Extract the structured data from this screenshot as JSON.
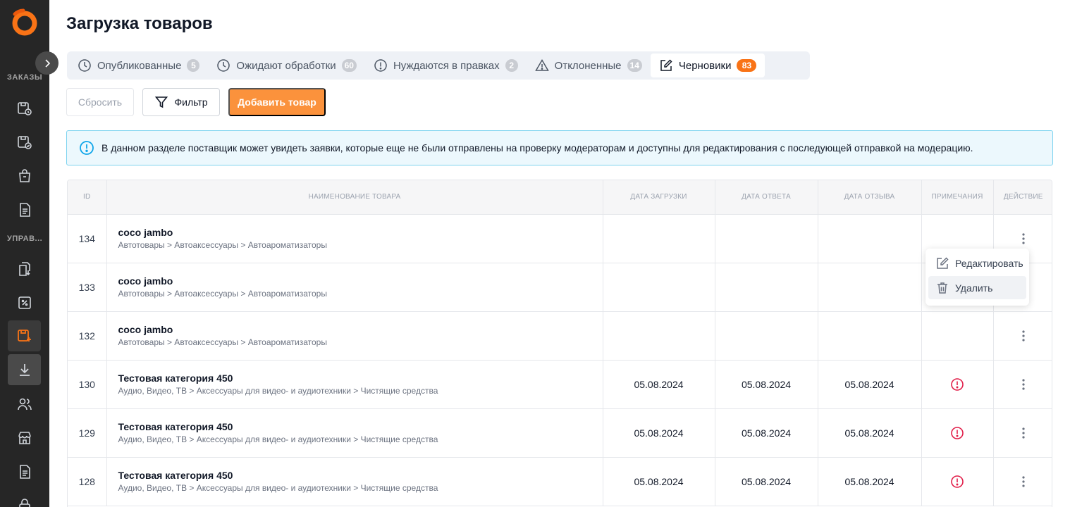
{
  "sidebar": {
    "section_orders": "ЗАКАЗЫ",
    "section_manage": "УПРАВ..."
  },
  "page": {
    "title": "Загрузка товаров"
  },
  "tabs": [
    {
      "label": "Опубликованные",
      "count": "5"
    },
    {
      "label": "Ожидают обработки",
      "count": "60"
    },
    {
      "label": "Нуждаются в правках",
      "count": "2"
    },
    {
      "label": "Отклоненные",
      "count": "14"
    },
    {
      "label": "Черновики",
      "count": "83"
    }
  ],
  "toolbar": {
    "reset_label": "Сбросить",
    "filter_label": "Фильтр",
    "add_label": "Добавить товар"
  },
  "info_text": "В данном разделе поставщик может увидеть заявки, которые еще не были отправлены на проверку модераторам и доступны для редактирования с последующей отправкой на модерацию.",
  "table": {
    "headers": {
      "id": "ID",
      "name": "НАИМЕНОВАНИЕ ТОВАРА",
      "upload_date": "ДАТА ЗАГРУЗКИ",
      "answer_date": "ДАТА ОТВЕТА",
      "review_date": "ДАТА ОТЗЫВА",
      "notes": "ПРИМЕЧАНИЯ",
      "action": "ДЕЙСТВИЕ"
    },
    "rows": [
      {
        "id": "134",
        "name": "coco jambo",
        "category": "Автотовары > Автоаксессуары > Автоароматизаторы",
        "upload": "",
        "answer": "",
        "review": ""
      },
      {
        "id": "133",
        "name": "coco jambo",
        "category": "Автотовары > Автоаксессуары > Автоароматизаторы",
        "upload": "",
        "answer": "",
        "review": ""
      },
      {
        "id": "132",
        "name": "coco jambo",
        "category": "Автотовары > Автоаксессуары > Автоароматизаторы",
        "upload": "",
        "answer": "",
        "review": ""
      },
      {
        "id": "130",
        "name": "Тестовая категория 450",
        "category": "Аудио, Видео, ТВ > Аксессуары для видео- и аудиотехники > Чистящие средства",
        "upload": "05.08.2024",
        "answer": "05.08.2024",
        "review": "05.08.2024"
      },
      {
        "id": "129",
        "name": "Тестовая категория 450",
        "category": "Аудио, Видео, ТВ > Аксессуары для видео- и аудиотехники > Чистящие средства",
        "upload": "05.08.2024",
        "answer": "05.08.2024",
        "review": "05.08.2024"
      },
      {
        "id": "128",
        "name": "Тестовая категория 450",
        "category": "Аудио, Видео, ТВ > Аксессуары для видео- и аудиотехники > Чистящие средства",
        "upload": "05.08.2024",
        "answer": "05.08.2024",
        "review": "05.08.2024"
      }
    ]
  },
  "row_menu": {
    "edit_label": "Редактировать",
    "delete_label": "Удалить"
  },
  "colors": {
    "accent": "#f97316",
    "add_button": "#fb923c",
    "sidebar_bg": "#262626",
    "info_border": "#7dd3ef",
    "warning_red": "#e11d48"
  }
}
